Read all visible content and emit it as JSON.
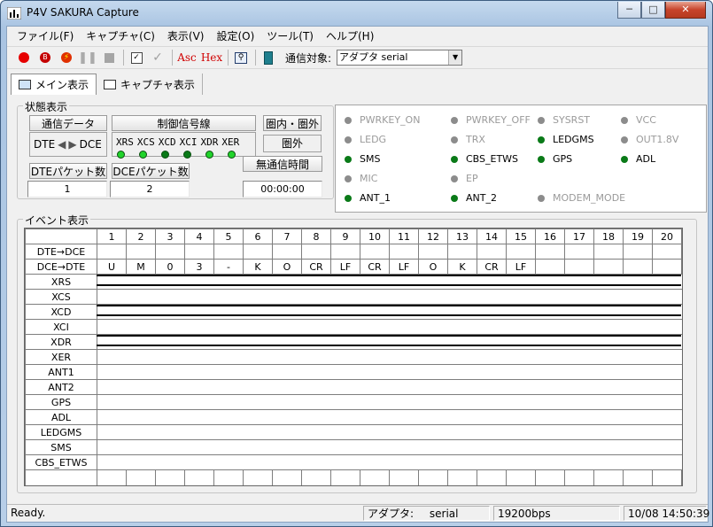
{
  "window": {
    "title": "P4V SAKURA Capture"
  },
  "menu": [
    "ファイル(F)",
    "キャプチャ(C)",
    "表示(V)",
    "設定(O)",
    "ツール(T)",
    "ヘルプ(H)"
  ],
  "toolbar": {
    "asc_label": "Asc",
    "hex_label": "Hex",
    "target_label": "通信対象:",
    "target_value": "アダプタ  serial"
  },
  "tabs": [
    {
      "label": "メイン表示",
      "active": true
    },
    {
      "label": "キャプチャ表示",
      "active": false
    }
  ],
  "state": {
    "title": "状態表示",
    "comm_data_btn": "通信データ",
    "dte_label": "DTE",
    "dce_label": "DCE",
    "ctrl_line_btn": "制御信号線",
    "ctrl_lines": [
      "XRS",
      "XCS",
      "XCD",
      "XCI",
      "XDR",
      "XER"
    ],
    "ctrl_led_colors": [
      "#21d32b",
      "#21d32b",
      "#0a7a18",
      "#0a7a18",
      "#21d32b",
      "#21d32b"
    ],
    "area_btn": "圏内・圏外",
    "area_value": "圏外",
    "dte_packets_btn": "DTEパケット数",
    "dte_packets_value": "1",
    "dce_packets_btn": "DCEパケット数",
    "dce_packets_value": "2",
    "idle_btn": "無通信時間",
    "idle_value": "00:00:00"
  },
  "status_items": [
    {
      "label": "PWRKEY_ON",
      "on": false
    },
    {
      "label": "PWRKEY_OFF",
      "on": false
    },
    {
      "label": "SYSRST",
      "on": false
    },
    {
      "label": "VCC",
      "on": false
    },
    {
      "label": "LEDG",
      "on": false
    },
    {
      "label": "TRX",
      "on": false
    },
    {
      "label": "LEDGMS",
      "on": true
    },
    {
      "label": "OUT1.8V",
      "on": false
    },
    {
      "label": "SMS",
      "on": true
    },
    {
      "label": "CBS_ETWS",
      "on": true
    },
    {
      "label": "GPS",
      "on": true
    },
    {
      "label": "ADL",
      "on": true
    },
    {
      "label": "MIC",
      "on": false
    },
    {
      "label": "EP",
      "on": false
    },
    {
      "label": "",
      "on": false
    },
    {
      "label": "",
      "on": false
    },
    {
      "label": "ANT_1",
      "on": true
    },
    {
      "label": "ANT_2",
      "on": true
    },
    {
      "label": "MODEM_MODE",
      "on": false
    }
  ],
  "events": {
    "title": "イベント表示",
    "columns": [
      "1",
      "2",
      "3",
      "4",
      "5",
      "6",
      "7",
      "8",
      "9",
      "10",
      "11",
      "12",
      "13",
      "14",
      "15",
      "16",
      "17",
      "18",
      "19",
      "20"
    ],
    "rows": [
      "DTE→DCE",
      "DCE→DTE",
      "XRS",
      "XCS",
      "XCD",
      "XCI",
      "XDR",
      "XER",
      "ANT1",
      "ANT2",
      "GPS",
      "ADL",
      "LEDGMS",
      "SMS",
      "CBS_ETWS"
    ],
    "dte_to_dce": [
      "",
      "",
      "",
      "",
      "",
      "",
      "",
      "",
      "",
      "",
      "",
      "",
      "",
      "",
      "",
      "",
      "",
      "",
      "",
      ""
    ],
    "dce_to_dte": [
      "U",
      "M",
      "0",
      "3",
      "-",
      "K",
      "O",
      "CR",
      "LF",
      "CR",
      "LF",
      "O",
      "K",
      "CR",
      "LF",
      "",
      "",
      "",
      "",
      ""
    ]
  },
  "statusbar": {
    "ready": "Ready.",
    "adapter_label": "アダプタ:",
    "adapter_value": "serial",
    "baud": "19200bps",
    "datetime": "10/08 14:50:39"
  },
  "colors": {
    "led_on": "#0a7a18",
    "led_off": "#8c8c8c",
    "led_bright": "#21d32b"
  }
}
